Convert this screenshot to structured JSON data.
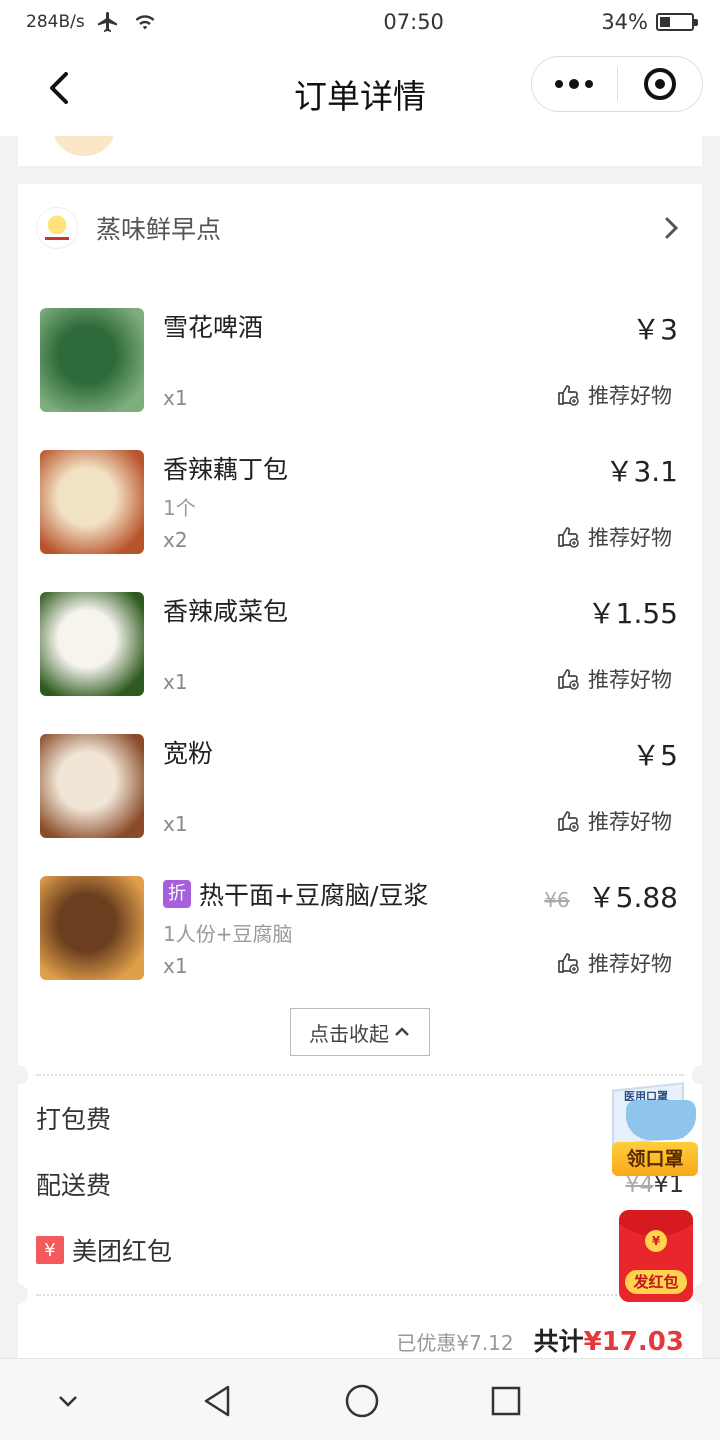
{
  "status_bar": {
    "net_speed": "284B/s",
    "time": "07:50",
    "battery": "34%",
    "battery_level": 0.34
  },
  "header": {
    "title": "订单详情"
  },
  "store": {
    "name": "蒸味鲜早点"
  },
  "items": [
    {
      "name": "雪花啤酒",
      "spec": "",
      "qty": "x1",
      "price": "￥3",
      "original_price": "",
      "discount_badge": "",
      "recommend": "推荐好物",
      "thumb_colors": [
        "#2f6b3a",
        "#7fae7d"
      ]
    },
    {
      "name": "香辣藕丁包",
      "spec": "1个",
      "qty": "x2",
      "price": "￥3.1",
      "original_price": "",
      "discount_badge": "",
      "recommend": "推荐好物",
      "thumb_colors": [
        "#f2e2c4",
        "#b8542c"
      ]
    },
    {
      "name": "香辣咸菜包",
      "spec": "",
      "qty": "x1",
      "price": "￥1.55",
      "original_price": "",
      "discount_badge": "",
      "recommend": "推荐好物",
      "thumb_colors": [
        "#f7f4ee",
        "#2d5a1e"
      ]
    },
    {
      "name": "宽粉",
      "spec": "",
      "qty": "x1",
      "price": "￥5",
      "original_price": "",
      "discount_badge": "",
      "recommend": "推荐好物",
      "thumb_colors": [
        "#f1e6d6",
        "#8a4b2a"
      ]
    },
    {
      "name": "热干面+豆腐脑/豆浆",
      "spec": "1人份+豆腐脑",
      "qty": "x1",
      "price": "￥5.88",
      "original_price": "¥6",
      "discount_badge": "折",
      "recommend": "推荐好物",
      "thumb_colors": [
        "#6b3e1f",
        "#e0a04a"
      ]
    }
  ],
  "collapse": {
    "label": "点击收起"
  },
  "fees": {
    "packaging": {
      "label": "打包费",
      "value": ""
    },
    "delivery": {
      "label": "配送费",
      "original": "¥4",
      "value": "¥1"
    },
    "redpacket": {
      "label": "美团红包",
      "icon": "¥",
      "value": ""
    }
  },
  "total": {
    "saved": "已优惠¥7.12",
    "label": "共计",
    "amount": "¥17.03"
  },
  "floating": {
    "mask_badge": {
      "box_text": "医用口罩",
      "label": "领口罩"
    },
    "hongbao": {
      "coin": "¥",
      "label": "发红包"
    }
  },
  "colors": {
    "accent_red": "#e4393c",
    "discount_purple": "#a75fdb"
  }
}
